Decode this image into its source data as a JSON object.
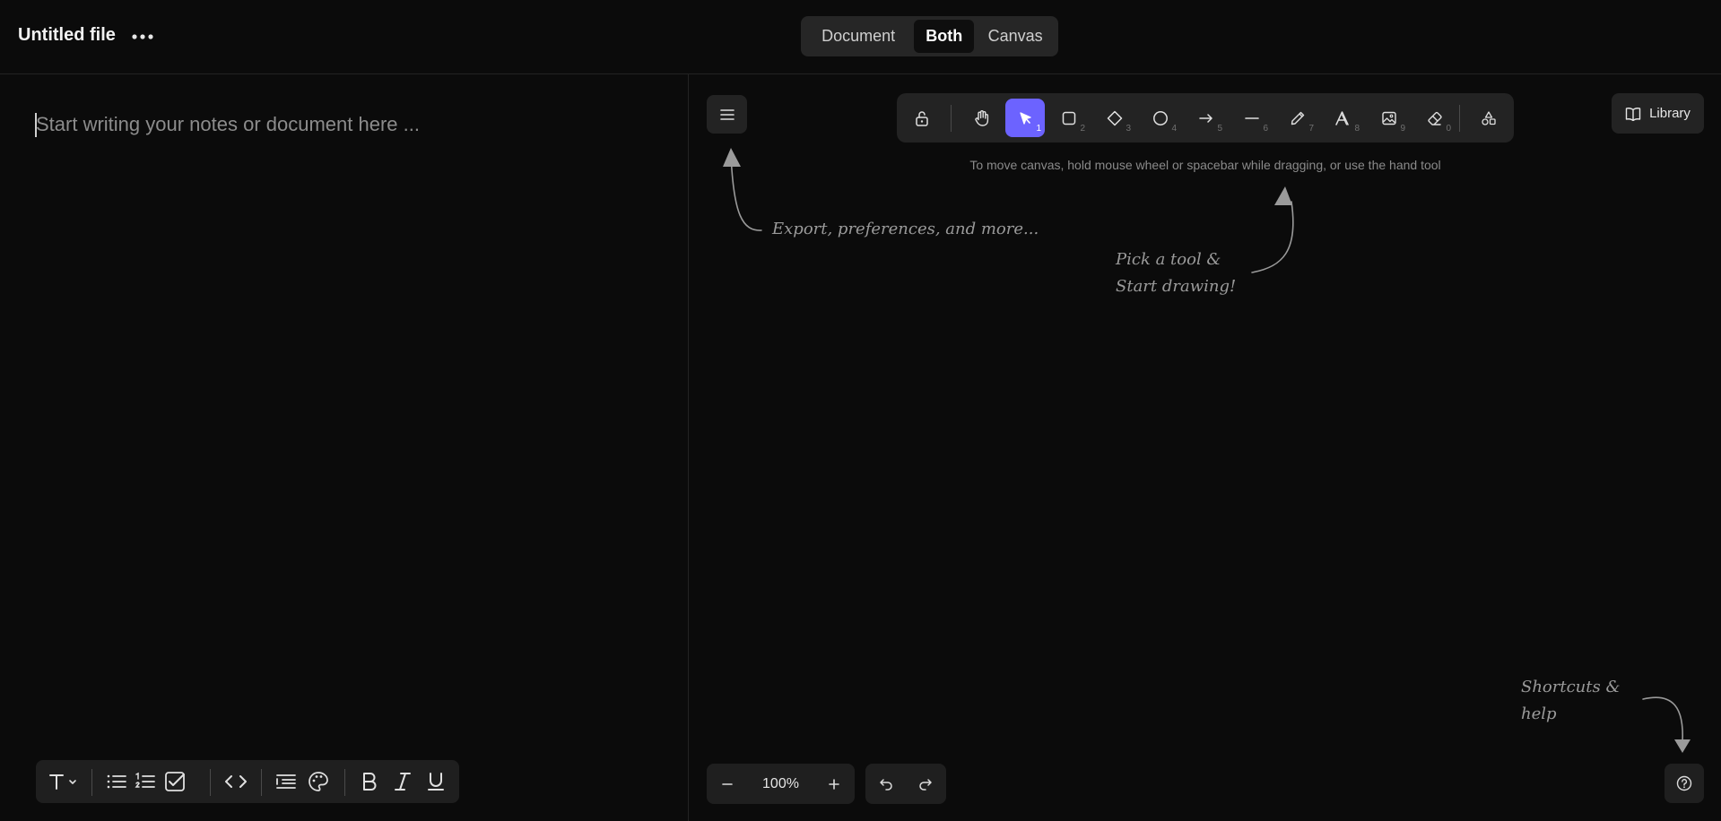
{
  "header": {
    "file_title": "Untitled file",
    "view_options": [
      "Document",
      "Both",
      "Canvas"
    ],
    "active_view": "Both"
  },
  "document": {
    "placeholder": "Start writing your notes or document here ..."
  },
  "canvas": {
    "tools": [
      {
        "name": "lock",
        "key": ""
      },
      {
        "name": "hand",
        "key": ""
      },
      {
        "name": "selection",
        "key": "1"
      },
      {
        "name": "rectangle",
        "key": "2"
      },
      {
        "name": "diamond",
        "key": "3"
      },
      {
        "name": "ellipse",
        "key": "4"
      },
      {
        "name": "arrow",
        "key": "5"
      },
      {
        "name": "line",
        "key": "6"
      },
      {
        "name": "draw",
        "key": "7"
      },
      {
        "name": "text",
        "key": "8"
      },
      {
        "name": "image",
        "key": "9"
      },
      {
        "name": "eraser",
        "key": "0"
      },
      {
        "name": "more-shapes",
        "key": ""
      }
    ],
    "active_tool": "selection",
    "hint": "To move canvas, hold mouse wheel or spacebar while dragging, or use the hand tool",
    "library_label": "Library",
    "zoom": "100%",
    "welcome_hints": {
      "menu": "Export, preferences, and more...",
      "tools_line1": "Pick a tool &",
      "tools_line2": "Start drawing!",
      "help_line1": "Shortcuts &",
      "help_line2": "help"
    }
  },
  "colors": {
    "accent": "#6c63ff",
    "background": "#0b0b0b",
    "panel": "#232323"
  }
}
